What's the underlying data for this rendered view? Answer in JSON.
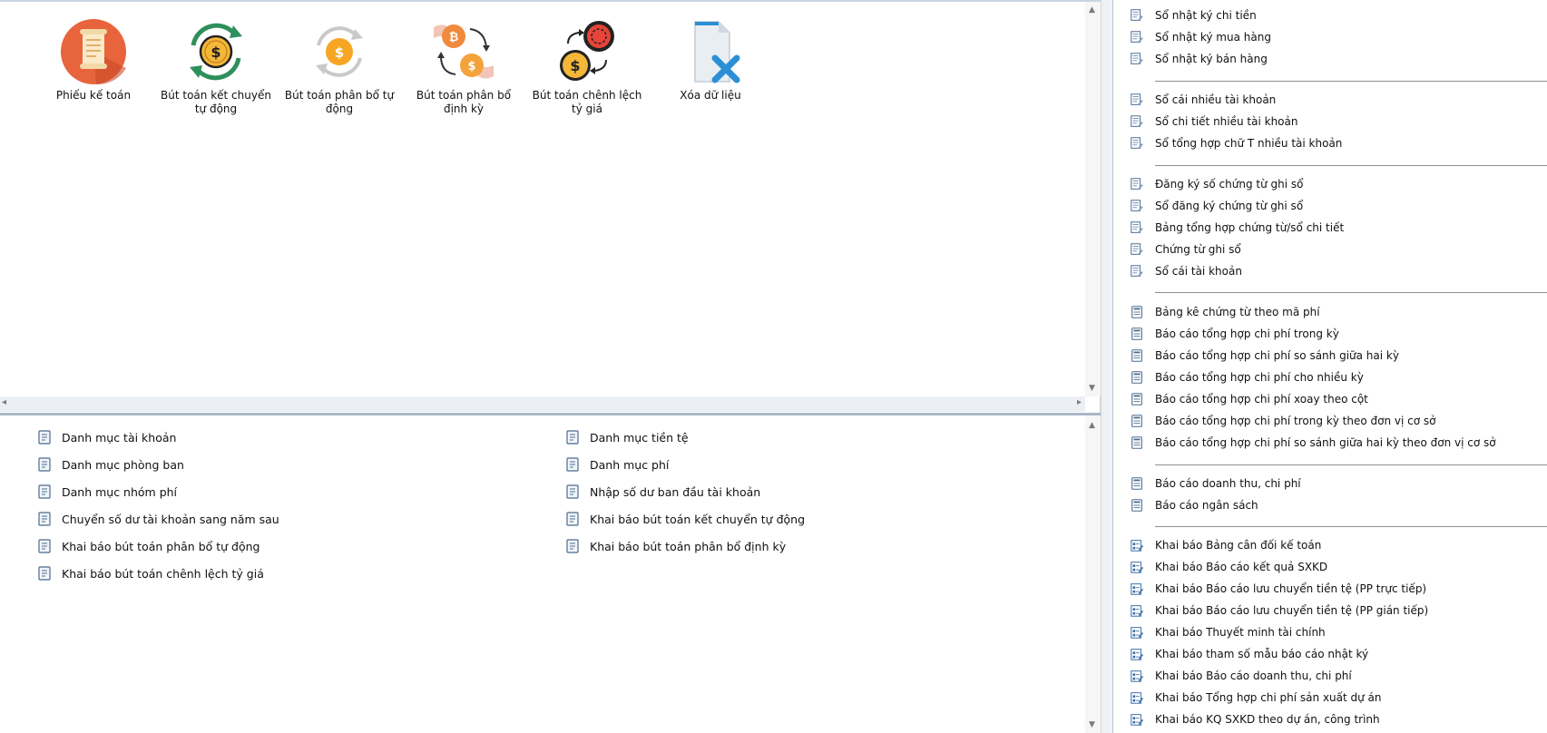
{
  "quick_actions": [
    {
      "label": "Phiếu kế toán",
      "icon": "document-icon"
    },
    {
      "label": "Bút toán kết chuyển tự động",
      "icon": "coin-cycle-icon"
    },
    {
      "label": "Bút toán phân bổ tự động",
      "icon": "coin-cycle-grey-icon"
    },
    {
      "label": "Bút toán phân bổ định kỳ",
      "icon": "coin-exchange-hands-icon"
    },
    {
      "label": "Bút toán chênh lệch tỷ giá",
      "icon": "currency-exchange-icon"
    },
    {
      "label": "Xóa dữ liệu",
      "icon": "delete-document-icon"
    }
  ],
  "catalog_left": [
    "Danh mục tài khoản",
    "Danh mục phòng ban",
    "Danh mục nhóm phí",
    "Chuyển số dư tài khoản sang năm sau",
    "Khai báo bút toán phân bổ tự động",
    "Khai báo bút toán chênh lệch tỷ giá"
  ],
  "catalog_right": [
    "Danh mục tiền tệ",
    "Danh mục phí",
    "Nhập số dư ban đầu tài khoản",
    "Khai báo bút toán kết chuyển tự động",
    "Khai báo bút toán phân bổ định kỳ"
  ],
  "reports": {
    "group1": [
      "Sổ nhật ký chi tiền",
      "Sổ nhật ký mua hàng",
      "Sổ nhật ký bán hàng"
    ],
    "group2": [
      "Sổ cái nhiều tài khoản",
      "Sổ chi tiết nhiều tài khoản",
      "Sổ tổng hợp chữ T nhiều tài khoản"
    ],
    "group3": [
      "Đăng ký số chứng từ ghi sổ",
      "Sổ đăng ký chứng từ ghi sổ",
      "Bảng tổng hợp chứng từ/sổ chi tiết",
      "Chứng từ ghi sổ",
      "Sổ cái tài khoản"
    ],
    "group4": [
      "Bảng kê chứng từ theo mã phí",
      "Báo cáo tổng hợp chi phí trong kỳ",
      "Báo cáo tổng hợp chi phí so sánh giữa hai kỳ",
      "Báo cáo tổng hợp chi phí cho nhiều kỳ",
      "Báo cáo tổng hợp chi phí xoay theo cột",
      "Báo cáo tổng hợp chi phí trong kỳ theo đơn vị cơ sở",
      "Báo cáo tổng hợp chi phí so sánh giữa hai kỳ theo đơn vị cơ sở"
    ],
    "group5": [
      "Báo cáo doanh thu, chi phí",
      "Báo cáo ngân sách"
    ],
    "group6": [
      "Khai báo Bảng cân đối kế toán",
      "Khai báo Báo cáo kết quả SXKD",
      "Khai báo Báo cáo lưu chuyển tiền tệ (PP trực tiếp)",
      "Khai báo Báo cáo lưu chuyển tiền tệ (PP gián tiếp)",
      "Khai báo Thuyết minh tài chính",
      "Khai báo tham số mẫu báo cáo nhật ký",
      "Khai báo Báo cáo doanh thu, chi phí",
      "Khai báo Tổng hợp chi phí sản xuất dự án",
      "Khai báo KQ SXKD theo dự án, công trình"
    ]
  },
  "colors": {
    "accent_orange": "#e8643c",
    "coin_gold": "#f4b73a",
    "coin_green": "#2f8f5b",
    "delete_blue": "#2b8fd6",
    "icon_blue": "#3a6ea5"
  }
}
